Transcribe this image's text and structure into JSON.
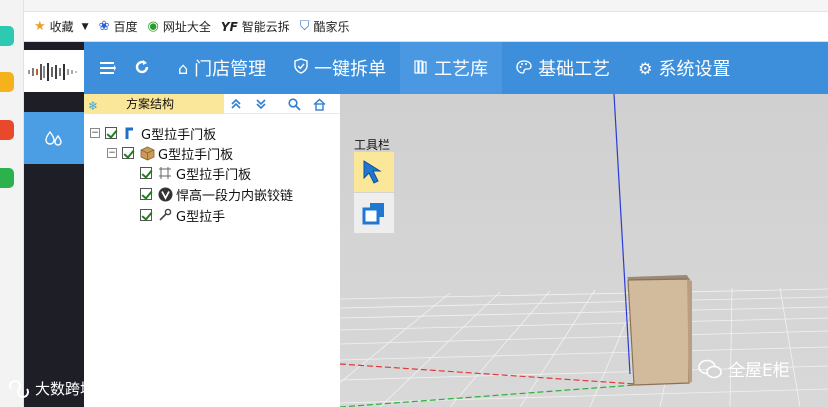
{
  "browser": {
    "bookmarks": [
      {
        "icon": "star-icon",
        "label": "收藏",
        "has_dropdown": true
      },
      {
        "icon": "paw-icon",
        "label": "百度"
      },
      {
        "icon": "globe-icon",
        "label": "网址大全"
      },
      {
        "icon": "yf-icon",
        "label": "智能云拆"
      },
      {
        "icon": "shield-icon",
        "label": "酷家乐"
      }
    ]
  },
  "nav": {
    "items": [
      {
        "icon": "home-icon",
        "label": "门店管理"
      },
      {
        "icon": "shield-check-icon",
        "label": "一键拆单"
      },
      {
        "icon": "book-icon",
        "label": "工艺库"
      },
      {
        "icon": "palette-icon",
        "label": "基础工艺"
      },
      {
        "icon": "gear-icon",
        "label": "系统设置"
      }
    ]
  },
  "tree": {
    "title": "方案结构",
    "nodes": [
      {
        "label": "G型拉手门板",
        "level": 0,
        "expander": "⊟",
        "icon": "g-handle-icon"
      },
      {
        "label": "G型拉手门板",
        "level": 1,
        "expander": "⊟",
        "icon": "box-icon"
      },
      {
        "label": "G型拉手门板",
        "level": 2,
        "icon": "panel-icon"
      },
      {
        "label": "悍高一段力内嵌铰链",
        "level": 2,
        "icon": "hinge-icon"
      },
      {
        "label": "G型拉手",
        "level": 2,
        "icon": "wrench-icon"
      }
    ]
  },
  "viewport": {
    "toolbar_label": "工具栏"
  },
  "watermarks": {
    "brand": "全屋E柜",
    "source": "大数跨境"
  },
  "colors": {
    "nav_bg": "#3e8fdb",
    "sidebar_dark": "#1e1f26",
    "sidebar_active": "#4b9ee4",
    "tree_header": "#fbe79a",
    "viewport_bg": "#d4d4d4",
    "door_panel": "#d2bb9c"
  }
}
